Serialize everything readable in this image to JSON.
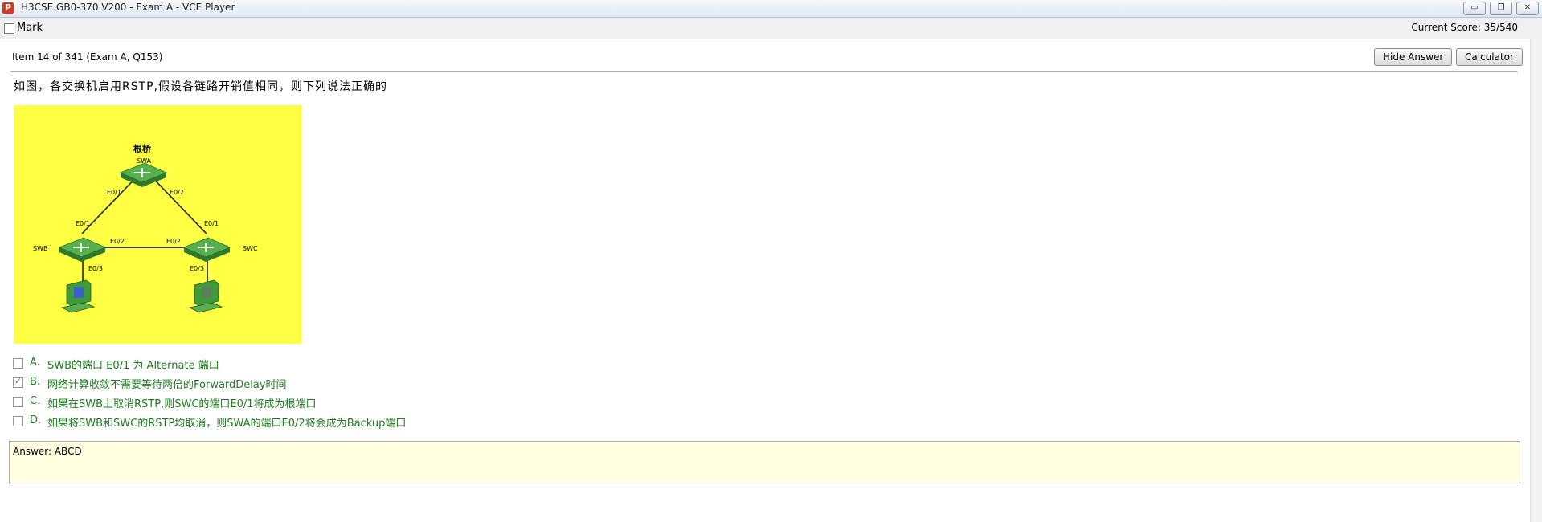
{
  "window": {
    "title": "H3CSE.GB0-370.V200 - Exam A - VCE Player",
    "app_icon": "P",
    "controls": {
      "minimize": "▭",
      "restore": "❐",
      "close": "✕"
    }
  },
  "toolbar": {
    "mark_label": "Mark",
    "score": "Current Score: 35/540"
  },
  "item": {
    "info": "Item 14 of 341  (Exam A, Q153)",
    "hide_answer_label": "Hide Answer",
    "calculator_label": "Calculator",
    "question": "如图，各交换机启用RSTP,假设各链路开销值相同，则下列说法正确的"
  },
  "diagram": {
    "background": "#ffff44",
    "root_label": "根桥",
    "swa": "SWA",
    "swb": "SWB",
    "swc": "SWC",
    "ports": {
      "swa_e01": "E0/1",
      "swa_e02": "E0/2",
      "swb_e01": "E0/1",
      "swb_e02": "E0/2",
      "swb_e03": "E0/3",
      "swc_e01": "E0/1",
      "swc_e02": "E0/2",
      "swc_e03": "E0/3"
    }
  },
  "options": [
    {
      "letter": "A.",
      "text": "SWB的端口 E0/1 为 Alternate 端口",
      "checked": false
    },
    {
      "letter": "B.",
      "text": "网络计算收敛不需要等待两倍的ForwardDelay时间",
      "checked": true
    },
    {
      "letter": "C.",
      "text": "如果在SWB上取消RSTP,则SWC的端口E0/1将成为根端口",
      "checked": false
    },
    {
      "letter": "D.",
      "text": "如果将SWB和SWC的RSTP均取消，则SWA的端口E0/2将会成为Backup端口",
      "checked": false
    }
  ],
  "answer": {
    "text": "Answer: ABCD"
  },
  "colors": {
    "option_text": "#1f7d1f",
    "answer_bg": "#ffffe0",
    "switch_green": "#3f9a3a"
  }
}
